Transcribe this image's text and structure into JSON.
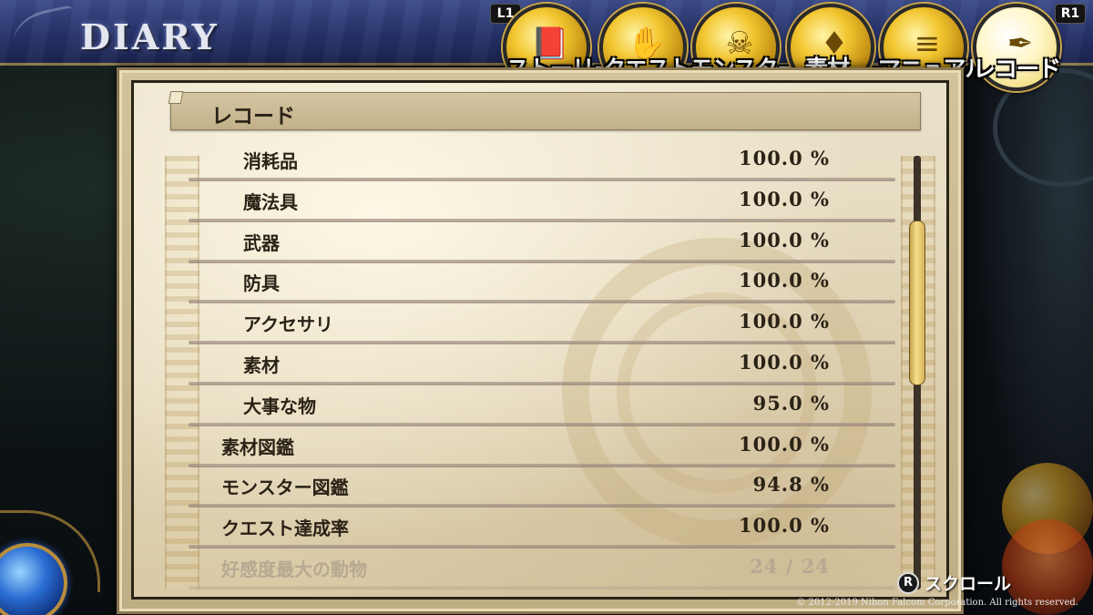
{
  "header": {
    "title": "DIARY",
    "left_shoulder": "L1",
    "right_shoulder": "R1"
  },
  "tabs": [
    {
      "label": "ストーリー",
      "icon": "book-icon",
      "active": false
    },
    {
      "label": "クエスト",
      "icon": "handshake-icon",
      "active": false
    },
    {
      "label": "モンスター",
      "icon": "dragon-icon",
      "active": false
    },
    {
      "label": "素材",
      "icon": "crystal-icon",
      "active": false
    },
    {
      "label": "マニュアル",
      "icon": "open-book-icon",
      "active": false
    },
    {
      "label": "レコード",
      "icon": "quill-icon",
      "active": true
    }
  ],
  "section": {
    "title": "レコード"
  },
  "records": [
    {
      "label": "消耗品",
      "value": "100.0 %",
      "indent": true
    },
    {
      "label": "魔法具",
      "value": "100.0 %",
      "indent": true
    },
    {
      "label": "武器",
      "value": "100.0 %",
      "indent": true
    },
    {
      "label": "防具",
      "value": "100.0 %",
      "indent": true
    },
    {
      "label": "アクセサリ",
      "value": "100.0 %",
      "indent": true
    },
    {
      "label": "素材",
      "value": "100.0 %",
      "indent": true
    },
    {
      "label": "大事な物",
      "value": "95.0 %",
      "indent": true
    },
    {
      "label": "素材図鑑",
      "value": "100.0 %",
      "indent": false
    },
    {
      "label": "モンスター図鑑",
      "value": "94.8 %",
      "indent": false
    },
    {
      "label": "クエスト達成率",
      "value": "100.0 %",
      "indent": false
    },
    {
      "label": "好感度最大の動物",
      "value": "24 / 24",
      "indent": false,
      "faded": true
    }
  ],
  "scrollbar": {
    "position_fraction": 0.24,
    "visible_fraction": 0.38
  },
  "footer": {
    "hint_button": "R",
    "hint_label": "スクロール",
    "copyright": "© 2012-2019 Nihon Falcom Corporation. All rights reserved."
  },
  "colors": {
    "header_blue": "#2a3672",
    "gold": "#f2c630",
    "paper": "#e6dbc0",
    "text_dark": "#2a2216"
  }
}
